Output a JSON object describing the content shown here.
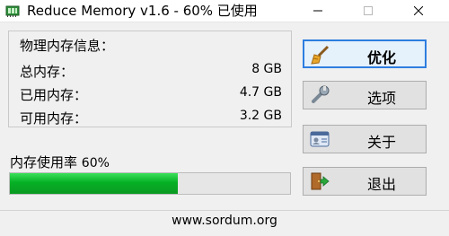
{
  "window": {
    "title": "Reduce Memory v1.6 - 60% 已使用",
    "controls": [
      "minimize-icon",
      "maximize-icon",
      "close-icon"
    ]
  },
  "memory_info": {
    "heading": "物理内存信息：",
    "rows": [
      {
        "label": "总内存：",
        "value": "8 GB"
      },
      {
        "label": "已用内存：",
        "value": "4.7 GB"
      },
      {
        "label": "可用内存：",
        "value": "3.2 GB"
      }
    ]
  },
  "usage": {
    "label": "内存使用率",
    "percent_text": "60%",
    "percent": 60,
    "bar_color": "#06b025"
  },
  "buttons": [
    {
      "label": "优化",
      "icon": "broom-icon"
    },
    {
      "label": "选项",
      "icon": "wrench-icon"
    },
    {
      "label": "关于",
      "icon": "id-card-icon"
    },
    {
      "label": "退出",
      "icon": "exit-door-icon"
    }
  ],
  "footer": {
    "text": "www.sordum.org"
  }
}
